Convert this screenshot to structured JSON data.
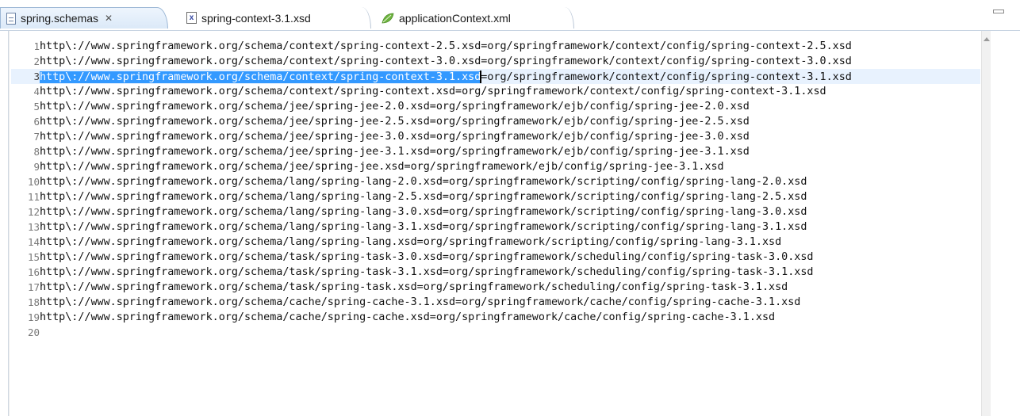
{
  "tabs": [
    {
      "label": "spring.schemas",
      "close": "✕",
      "icon": "text-file-icon",
      "active": true
    },
    {
      "label": "spring-context-3.1.xsd",
      "icon": "xsd-file-icon",
      "icon_glyph": "x",
      "active": false
    },
    {
      "label": "applicationContext.xml",
      "icon": "spring-leaf-icon",
      "active": false
    }
  ],
  "colors": {
    "selection": "#3399ff",
    "current_line": "#e8f2fe",
    "leaf_icon": "#6db33f",
    "line_number": "#787878"
  },
  "editor": {
    "current_line": 3,
    "lines": [
      {
        "num": "1",
        "text": "http\\://www.springframework.org/schema/context/spring-context-2.5.xsd=org/springframework/context/config/spring-context-2.5.xsd"
      },
      {
        "num": "2",
        "text": "http\\://www.springframework.org/schema/context/spring-context-3.0.xsd=org/springframework/context/config/spring-context-3.0.xsd"
      },
      {
        "num": "3",
        "text_selected": "http\\://www.springframework.org/schema/context/spring-context-3.1.xsd",
        "text_rest": "=org/springframework/context/config/spring-context-3.1.xsd"
      },
      {
        "num": "4",
        "text": "http\\://www.springframework.org/schema/context/spring-context.xsd=org/springframework/context/config/spring-context-3.1.xsd"
      },
      {
        "num": "5",
        "text": "http\\://www.springframework.org/schema/jee/spring-jee-2.0.xsd=org/springframework/ejb/config/spring-jee-2.0.xsd"
      },
      {
        "num": "6",
        "text": "http\\://www.springframework.org/schema/jee/spring-jee-2.5.xsd=org/springframework/ejb/config/spring-jee-2.5.xsd"
      },
      {
        "num": "7",
        "text": "http\\://www.springframework.org/schema/jee/spring-jee-3.0.xsd=org/springframework/ejb/config/spring-jee-3.0.xsd"
      },
      {
        "num": "8",
        "text": "http\\://www.springframework.org/schema/jee/spring-jee-3.1.xsd=org/springframework/ejb/config/spring-jee-3.1.xsd"
      },
      {
        "num": "9",
        "text": "http\\://www.springframework.org/schema/jee/spring-jee.xsd=org/springframework/ejb/config/spring-jee-3.1.xsd"
      },
      {
        "num": "10",
        "text": "http\\://www.springframework.org/schema/lang/spring-lang-2.0.xsd=org/springframework/scripting/config/spring-lang-2.0.xsd"
      },
      {
        "num": "11",
        "text": "http\\://www.springframework.org/schema/lang/spring-lang-2.5.xsd=org/springframework/scripting/config/spring-lang-2.5.xsd"
      },
      {
        "num": "12",
        "text": "http\\://www.springframework.org/schema/lang/spring-lang-3.0.xsd=org/springframework/scripting/config/spring-lang-3.0.xsd"
      },
      {
        "num": "13",
        "text": "http\\://www.springframework.org/schema/lang/spring-lang-3.1.xsd=org/springframework/scripting/config/spring-lang-3.1.xsd"
      },
      {
        "num": "14",
        "text": "http\\://www.springframework.org/schema/lang/spring-lang.xsd=org/springframework/scripting/config/spring-lang-3.1.xsd"
      },
      {
        "num": "15",
        "text": "http\\://www.springframework.org/schema/task/spring-task-3.0.xsd=org/springframework/scheduling/config/spring-task-3.0.xsd"
      },
      {
        "num": "16",
        "text": "http\\://www.springframework.org/schema/task/spring-task-3.1.xsd=org/springframework/scheduling/config/spring-task-3.1.xsd"
      },
      {
        "num": "17",
        "text": "http\\://www.springframework.org/schema/task/spring-task.xsd=org/springframework/scheduling/config/spring-task-3.1.xsd"
      },
      {
        "num": "18",
        "text": "http\\://www.springframework.org/schema/cache/spring-cache-3.1.xsd=org/springframework/cache/config/spring-cache-3.1.xsd"
      },
      {
        "num": "19",
        "text": "http\\://www.springframework.org/schema/cache/spring-cache.xsd=org/springframework/cache/config/spring-cache-3.1.xsd"
      },
      {
        "num": "20",
        "text": ""
      }
    ]
  }
}
